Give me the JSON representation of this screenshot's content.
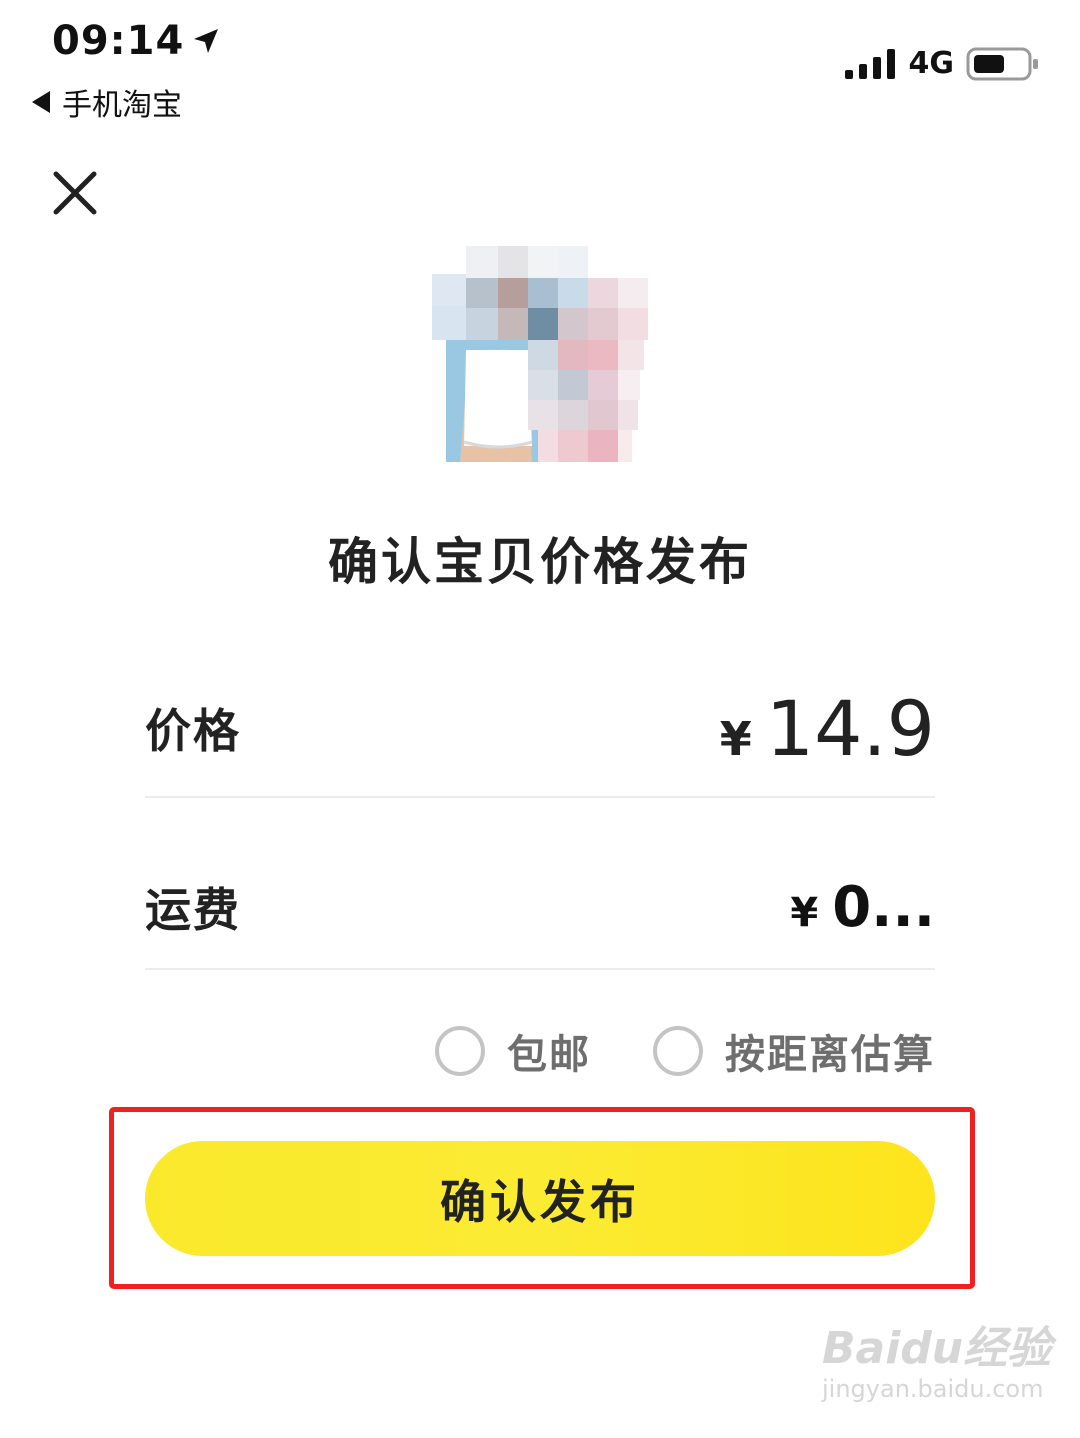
{
  "status_bar": {
    "time": "09:14",
    "back_app": "手机淘宝",
    "network": "4G",
    "battery_level": 0.6
  },
  "title": "确认宝贝价格发布",
  "price": {
    "label": "价格",
    "currency": "¥",
    "value": "14.9"
  },
  "shipping": {
    "label": "运费",
    "currency": "¥",
    "value": "0..."
  },
  "shipping_options": [
    {
      "label": "包邮",
      "selected": false
    },
    {
      "label": "按距离估算",
      "selected": false
    }
  ],
  "confirm_button": "确认发布",
  "colors": {
    "button_yellow": "#fbeb33",
    "highlight_red": "#f0201e",
    "radio_gray": "#c4c4c4",
    "option_text": "#6e6e6e"
  },
  "icons": {
    "close": "close-icon",
    "location": "location-arrow-icon",
    "back": "back-triangle-icon",
    "signal": "signal-icon",
    "battery": "battery-icon"
  },
  "watermark": {
    "main": "Baidu经验",
    "sub": "jingyan.baidu.com"
  }
}
